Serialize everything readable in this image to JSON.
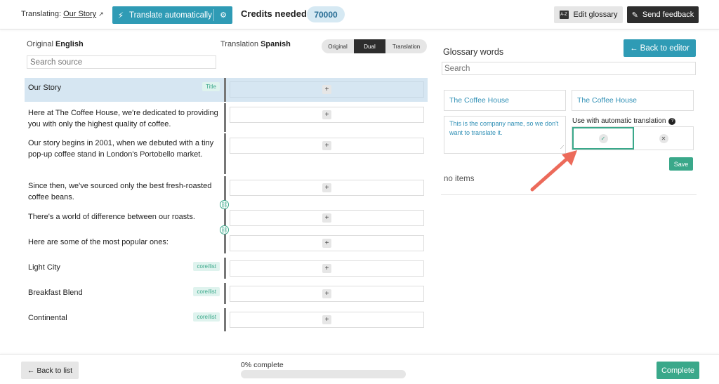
{
  "header": {
    "translating_label": "Translating:",
    "story_link": "Our Story",
    "translate_button": "Translate automatically",
    "credits_label": "Credits needed",
    "credits_value": "70000",
    "edit_glossary": "Edit glossary",
    "glossary_icon_text": "A-Z",
    "send_feedback": "Send feedback"
  },
  "editor": {
    "original_label": "Original",
    "original_lang": "English",
    "translation_label": "Translation",
    "translation_lang": "Spanish",
    "view_modes": [
      "Original",
      "Dual",
      "Translation"
    ],
    "active_view": "Dual",
    "search_placeholder": "Search source",
    "rows": [
      {
        "text": "Our Story",
        "tag": "Title",
        "selected": true
      },
      {
        "text": "Here at The Coffee House, we're dedicated to providing you with only the highest quality of coffee.",
        "tag": ""
      },
      {
        "text": "Our story begins in 2001, when we debuted with a tiny pop-up coffee stand in London's Portobello market.",
        "tag": ""
      },
      {
        "text": "Since then, we've sourced only the best fresh-roasted coffee beans.",
        "tag": ""
      },
      {
        "text": "There's a world of difference between our roasts.",
        "tag": ""
      },
      {
        "text": "Here are some of the most popular ones:",
        "tag": ""
      },
      {
        "text": "Light City",
        "tag": "core/list"
      },
      {
        "text": "Breakfast Blend",
        "tag": "core/list"
      },
      {
        "text": "Continental",
        "tag": "core/list"
      }
    ]
  },
  "glossary": {
    "back_to_editor": "← Back to editor",
    "title": "Glossary words",
    "search_placeholder": "Search",
    "source_term": "The Coffee House",
    "target_term": "The Coffee House",
    "note": "This is the company name, so we don't want to translate it.",
    "auto_label": "Use with automatic translation",
    "auto_enabled": true,
    "save": "Save",
    "empty_text": "no items"
  },
  "footer": {
    "back_to_list": "← Back to list",
    "progress_label": "0% complete",
    "progress": 0,
    "complete": "Complete"
  },
  "colors": {
    "accent_blue": "#2f9bb5",
    "accent_green": "#3aa88a",
    "selected_row": "#d6e6f2",
    "arrow": "#ec6a5a"
  }
}
